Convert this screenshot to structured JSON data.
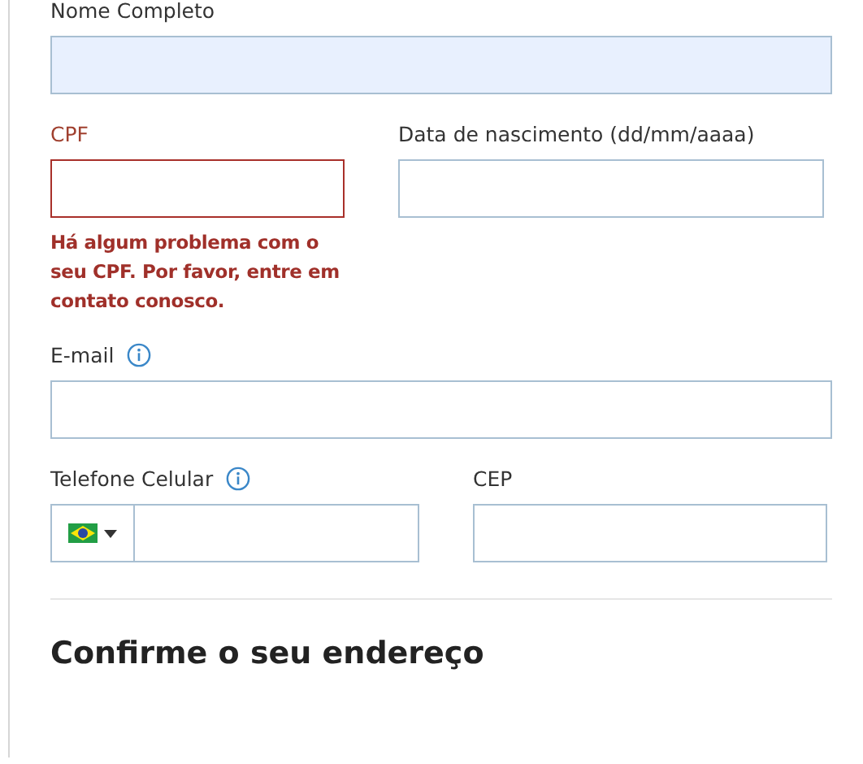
{
  "rows": [
    {
      "fields": [
        {
          "kind": "text",
          "label": "Nome Completo",
          "autofilled": true,
          "invalid": false,
          "info": false
        }
      ]
    },
    {
      "fields": [
        {
          "kind": "text",
          "label": "CPF",
          "autofilled": false,
          "invalid": true,
          "info": false,
          "error": "Há algum problema com o seu CPF. Por favor, entre em contato conosco."
        },
        {
          "kind": "text",
          "label": "Data de nascimento (dd/mm/aaaa)",
          "autofilled": false,
          "invalid": false,
          "info": false
        }
      ]
    },
    {
      "fields": [
        {
          "kind": "text",
          "label": "E-mail",
          "autofilled": false,
          "invalid": false,
          "info": true
        }
      ]
    },
    {
      "fields": [
        {
          "kind": "phone",
          "label": "Telefone Celular",
          "autofilled": false,
          "invalid": false,
          "info": true
        },
        {
          "kind": "text",
          "label": "CEP",
          "autofilled": false,
          "invalid": false,
          "info": false
        }
      ]
    }
  ],
  "section_heading": "Confirme o seu endereço"
}
